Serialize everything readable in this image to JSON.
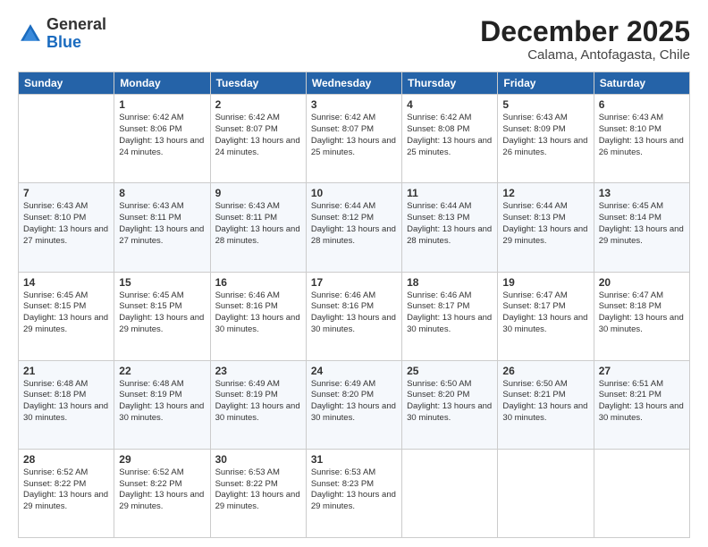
{
  "header": {
    "logo_general": "General",
    "logo_blue": "Blue",
    "month_title": "December 2025",
    "subtitle": "Calama, Antofagasta, Chile"
  },
  "days_of_week": [
    "Sunday",
    "Monday",
    "Tuesday",
    "Wednesday",
    "Thursday",
    "Friday",
    "Saturday"
  ],
  "weeks": [
    [
      {
        "day": "",
        "content": ""
      },
      {
        "day": "1",
        "content": "Sunrise: 6:42 AM\nSunset: 8:06 PM\nDaylight: 13 hours\nand 24 minutes."
      },
      {
        "day": "2",
        "content": "Sunrise: 6:42 AM\nSunset: 8:07 PM\nDaylight: 13 hours\nand 24 minutes."
      },
      {
        "day": "3",
        "content": "Sunrise: 6:42 AM\nSunset: 8:07 PM\nDaylight: 13 hours\nand 25 minutes."
      },
      {
        "day": "4",
        "content": "Sunrise: 6:42 AM\nSunset: 8:08 PM\nDaylight: 13 hours\nand 25 minutes."
      },
      {
        "day": "5",
        "content": "Sunrise: 6:43 AM\nSunset: 8:09 PM\nDaylight: 13 hours\nand 26 minutes."
      },
      {
        "day": "6",
        "content": "Sunrise: 6:43 AM\nSunset: 8:10 PM\nDaylight: 13 hours\nand 26 minutes."
      }
    ],
    [
      {
        "day": "7",
        "content": "Sunrise: 6:43 AM\nSunset: 8:10 PM\nDaylight: 13 hours\nand 27 minutes."
      },
      {
        "day": "8",
        "content": "Sunrise: 6:43 AM\nSunset: 8:11 PM\nDaylight: 13 hours\nand 27 minutes."
      },
      {
        "day": "9",
        "content": "Sunrise: 6:43 AM\nSunset: 8:11 PM\nDaylight: 13 hours\nand 28 minutes."
      },
      {
        "day": "10",
        "content": "Sunrise: 6:44 AM\nSunset: 8:12 PM\nDaylight: 13 hours\nand 28 minutes."
      },
      {
        "day": "11",
        "content": "Sunrise: 6:44 AM\nSunset: 8:13 PM\nDaylight: 13 hours\nand 28 minutes."
      },
      {
        "day": "12",
        "content": "Sunrise: 6:44 AM\nSunset: 8:13 PM\nDaylight: 13 hours\nand 29 minutes."
      },
      {
        "day": "13",
        "content": "Sunrise: 6:45 AM\nSunset: 8:14 PM\nDaylight: 13 hours\nand 29 minutes."
      }
    ],
    [
      {
        "day": "14",
        "content": "Sunrise: 6:45 AM\nSunset: 8:15 PM\nDaylight: 13 hours\nand 29 minutes."
      },
      {
        "day": "15",
        "content": "Sunrise: 6:45 AM\nSunset: 8:15 PM\nDaylight: 13 hours\nand 29 minutes."
      },
      {
        "day": "16",
        "content": "Sunrise: 6:46 AM\nSunset: 8:16 PM\nDaylight: 13 hours\nand 30 minutes."
      },
      {
        "day": "17",
        "content": "Sunrise: 6:46 AM\nSunset: 8:16 PM\nDaylight: 13 hours\nand 30 minutes."
      },
      {
        "day": "18",
        "content": "Sunrise: 6:46 AM\nSunset: 8:17 PM\nDaylight: 13 hours\nand 30 minutes."
      },
      {
        "day": "19",
        "content": "Sunrise: 6:47 AM\nSunset: 8:17 PM\nDaylight: 13 hours\nand 30 minutes."
      },
      {
        "day": "20",
        "content": "Sunrise: 6:47 AM\nSunset: 8:18 PM\nDaylight: 13 hours\nand 30 minutes."
      }
    ],
    [
      {
        "day": "21",
        "content": "Sunrise: 6:48 AM\nSunset: 8:18 PM\nDaylight: 13 hours\nand 30 minutes."
      },
      {
        "day": "22",
        "content": "Sunrise: 6:48 AM\nSunset: 8:19 PM\nDaylight: 13 hours\nand 30 minutes."
      },
      {
        "day": "23",
        "content": "Sunrise: 6:49 AM\nSunset: 8:19 PM\nDaylight: 13 hours\nand 30 minutes."
      },
      {
        "day": "24",
        "content": "Sunrise: 6:49 AM\nSunset: 8:20 PM\nDaylight: 13 hours\nand 30 minutes."
      },
      {
        "day": "25",
        "content": "Sunrise: 6:50 AM\nSunset: 8:20 PM\nDaylight: 13 hours\nand 30 minutes."
      },
      {
        "day": "26",
        "content": "Sunrise: 6:50 AM\nSunset: 8:21 PM\nDaylight: 13 hours\nand 30 minutes."
      },
      {
        "day": "27",
        "content": "Sunrise: 6:51 AM\nSunset: 8:21 PM\nDaylight: 13 hours\nand 30 minutes."
      }
    ],
    [
      {
        "day": "28",
        "content": "Sunrise: 6:52 AM\nSunset: 8:22 PM\nDaylight: 13 hours\nand 29 minutes."
      },
      {
        "day": "29",
        "content": "Sunrise: 6:52 AM\nSunset: 8:22 PM\nDaylight: 13 hours\nand 29 minutes."
      },
      {
        "day": "30",
        "content": "Sunrise: 6:53 AM\nSunset: 8:22 PM\nDaylight: 13 hours\nand 29 minutes."
      },
      {
        "day": "31",
        "content": "Sunrise: 6:53 AM\nSunset: 8:23 PM\nDaylight: 13 hours\nand 29 minutes."
      },
      {
        "day": "",
        "content": ""
      },
      {
        "day": "",
        "content": ""
      },
      {
        "day": "",
        "content": ""
      }
    ]
  ]
}
